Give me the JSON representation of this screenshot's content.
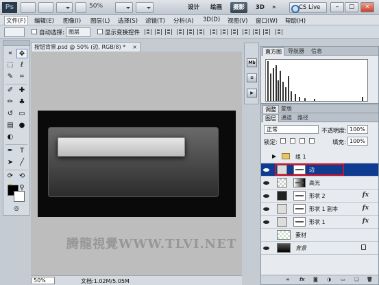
{
  "app": {
    "logo": "Ps",
    "zoom": "50%",
    "workspaces": [
      "设计",
      "绘画",
      "摄影",
      "3D"
    ],
    "active_workspace": "摄影",
    "more": "»",
    "cs_live": "CS Live"
  },
  "menu": [
    "文件(F)",
    "编辑(E)",
    "图像(I)",
    "图层(L)",
    "选择(S)",
    "滤镜(T)",
    "分析(A)",
    "3D(D)",
    "视图(V)",
    "窗口(W)",
    "帮助(H)"
  ],
  "options": {
    "auto_select_label": "自动选择:",
    "auto_select_value": "图层",
    "show_transform_label": "显示变换控件"
  },
  "document": {
    "tab_title": "按钮背景.psd @ 50% (边, RGB/8) *",
    "close": "×",
    "watermark": "腾龍視覺WWW.TLVI.NET",
    "status_zoom": "50%",
    "status_doc": "文档:1.02M/5.05M"
  },
  "histogram_panel": {
    "tabs": [
      "直方图",
      "导航器",
      "信息"
    ]
  },
  "adjust_panel": {
    "tabs": [
      "调整",
      "蒙版"
    ]
  },
  "layers_panel": {
    "tabs": [
      "图层",
      "通道",
      "路径"
    ],
    "blend_mode": "正常",
    "opacity_label": "不透明度:",
    "opacity_value": "100%",
    "lock_label": "锁定:",
    "fill_label": "填充:",
    "fill_value": "100%",
    "layers": [
      {
        "name": "组 1",
        "kind": "group",
        "visible": false,
        "selected": false,
        "fx": ""
      },
      {
        "name": "边",
        "kind": "shape",
        "visible": true,
        "selected": true,
        "fx": ""
      },
      {
        "name": "高光",
        "kind": "gradient",
        "visible": true,
        "selected": false,
        "fx": ""
      },
      {
        "name": "形状 2",
        "kind": "shape",
        "visible": true,
        "selected": false,
        "fx": "fx"
      },
      {
        "name": "形状 1 副本",
        "kind": "shape",
        "visible": true,
        "selected": false,
        "fx": "fx"
      },
      {
        "name": "形状 1",
        "kind": "shape",
        "visible": true,
        "selected": false,
        "fx": "fx"
      },
      {
        "name": "素材",
        "kind": "image",
        "visible": false,
        "selected": false,
        "fx": ""
      },
      {
        "name": "背景",
        "kind": "background",
        "visible": true,
        "selected": false,
        "fx": ""
      }
    ],
    "footer_icons": [
      "link-icon",
      "fx-icon",
      "mask-icon",
      "adjustment-icon",
      "folder-icon",
      "new-layer-icon",
      "trash-icon"
    ]
  },
  "colors": {
    "selection": "#0f3b91",
    "highlight_box": "#d0122b"
  }
}
